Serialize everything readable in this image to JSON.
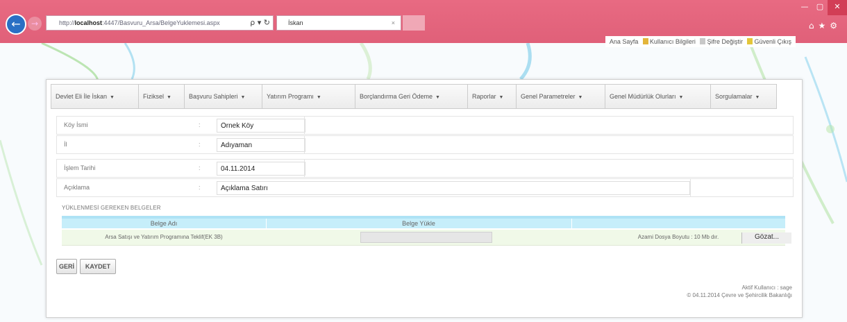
{
  "browser": {
    "address_prefix": "http://",
    "address_host": "localhost",
    "address_rest": ":4447/Basvuru_Arsa/BelgeYuklemesi.aspx",
    "address_tools": "ρ ▾ ↻",
    "tab_title": "İskan",
    "tab_close": "×",
    "back_icon": "←",
    "forward_icon": "→",
    "min_icon": "—",
    "max_icon": "▢",
    "close_icon": "✕",
    "toolbar_icons": "⌂★⚙"
  },
  "toplinks": [
    "Ana Sayfa",
    "Kullanıcı Bilgileri",
    "Şifre Değiştir",
    "Güvenli Çıkış"
  ],
  "menu": [
    "Devlet Eli İle İskan",
    "Fiziksel",
    "Başvuru Sahipleri",
    "Yatırım Programı",
    "Borçlandırma Geri Ödeme",
    "Raporlar",
    "Genel Parametreler",
    "Genel Müdürlük Olurları",
    "Sorgulamalar"
  ],
  "menu_arrow": "▼",
  "form": {
    "colon": ":",
    "rows": [
      {
        "label": "Köy İsmi",
        "value": "Örnek Köy"
      },
      {
        "label": "İl",
        "value": "Adıyaman"
      },
      {
        "label": "İşlem Tarihi",
        "value": "04.11.2014"
      },
      {
        "label": "Açıklama",
        "value": "Açıklama Satırı"
      }
    ]
  },
  "documents": {
    "title": "YÜKLENMESİ GEREKEN BELGELER",
    "headers": [
      "Belge Adı",
      "Belge Yükle",
      ""
    ],
    "rows": [
      {
        "name": "Arsa Satışı ve Yatırım Programına Teklif(EK 3B)",
        "browse": "Gözat...",
        "size_note": "Azami Dosya Boyutu : 10 Mb dır."
      }
    ]
  },
  "buttons": {
    "back": "GERİ",
    "save": "KAYDET"
  },
  "footer": {
    "user_line": "Aktif Kullanıcı : sage",
    "copyright": "© 04.11.2014 Çevre ve Şehircilik Bakanlığı"
  },
  "colors": {
    "chrome": "#e06079",
    "accent": "#c6eefa",
    "row": "#f0f9e8"
  }
}
